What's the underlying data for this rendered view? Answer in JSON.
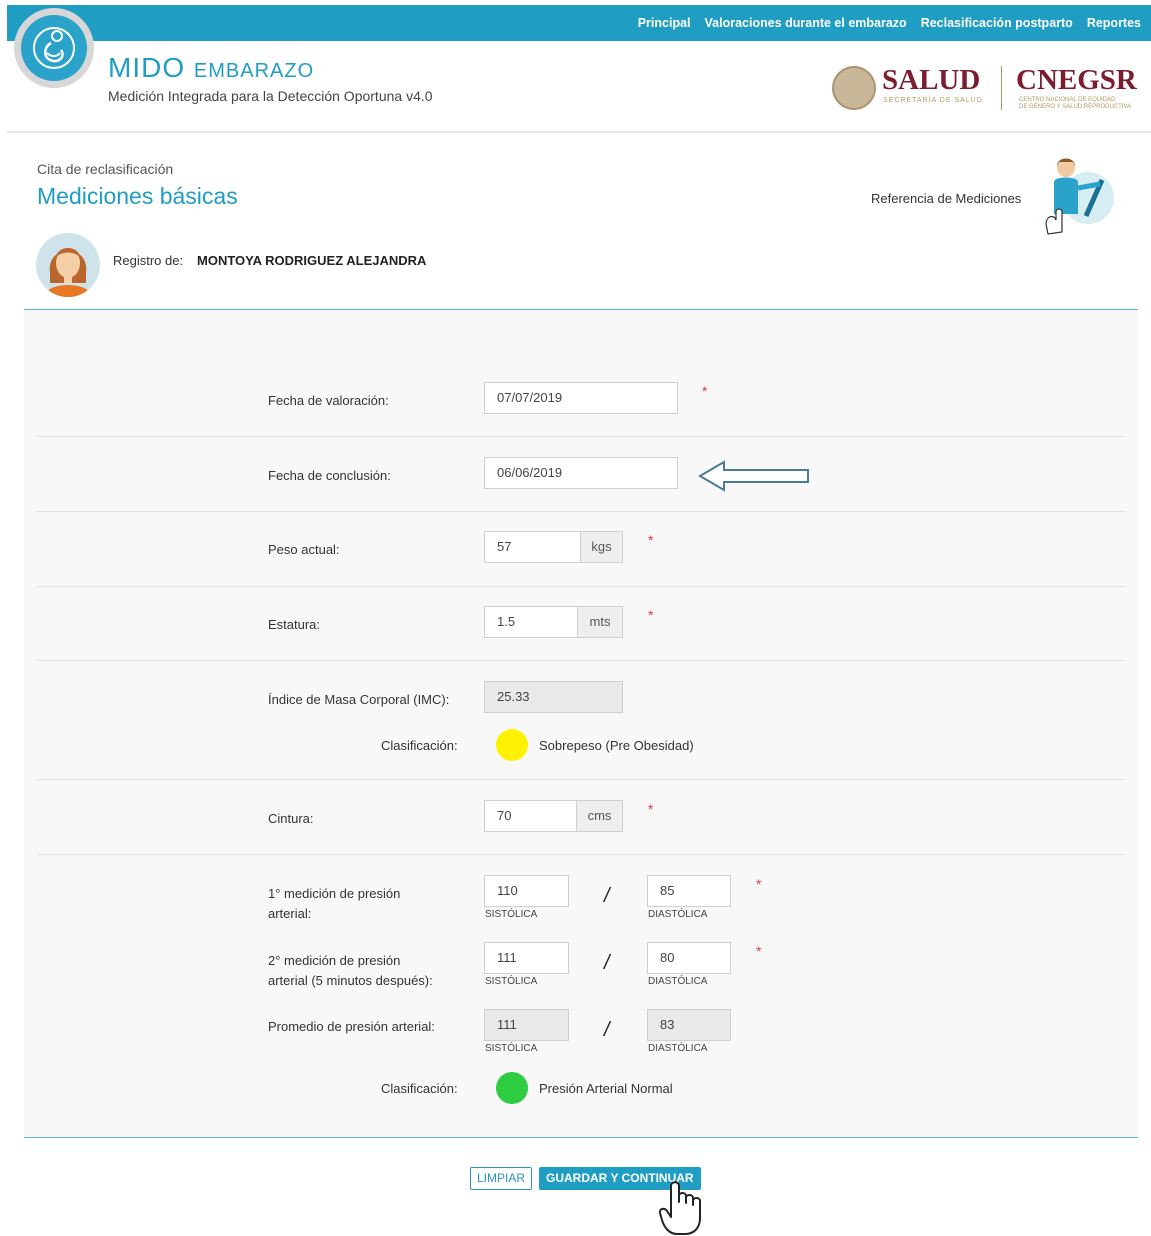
{
  "nav": {
    "items": [
      "Principal",
      "Valoraciones durante el embarazo",
      "Reclasificación postparto",
      "Reportes"
    ]
  },
  "brand": {
    "title_main": "MIDO",
    "title_small": "EMBARAZO",
    "subtitle": "Medición Integrada para la Detección Oportuna v4.0"
  },
  "partners": {
    "salud": "SALUD",
    "salud_sub": "SECRETARÍA DE SALUD",
    "cnegsr": "CNEGSR",
    "cnegsr_sub1": "CENTRO NACIONAL DE EQUIDAD",
    "cnegsr_sub2": "DE GÉNERO Y SALUD REPRODUCTIVA"
  },
  "page": {
    "breadcrumb": "Cita de reclasificación",
    "title": "Mediciones básicas",
    "reference_link": "Referencia de Mediciones",
    "registro_label": "Registro de:",
    "patient_name": "MONTOYA RODRIGUEZ ALEJANDRA"
  },
  "form": {
    "fecha_valoracion": {
      "label": "Fecha de valoración:",
      "value": "07/07/2019"
    },
    "fecha_conclusion": {
      "label": "Fecha de conclusión:",
      "value": "06/06/2019"
    },
    "peso": {
      "label": "Peso actual:",
      "value": "57",
      "unit": "kgs"
    },
    "estatura": {
      "label": "Estatura:",
      "value": "1.5",
      "unit": "mts"
    },
    "imc": {
      "label": "Índice de Masa Corporal (IMC):",
      "value": "25.33"
    },
    "imc_clasificacion": {
      "label": "Clasificación:",
      "text": "Sobrepeso (Pre Obesidad)",
      "color": "#fff200"
    },
    "cintura": {
      "label": "Cintura:",
      "value": "70",
      "unit": "cms"
    },
    "presion1": {
      "label_line1": "1° medición de presión",
      "label_line2": "arterial:",
      "sistolica": "110",
      "diastolica": "85"
    },
    "presion2": {
      "label_line1": "2° medición de presión",
      "label_line2": "arterial (5 minutos después):",
      "sistolica": "111",
      "diastolica": "80"
    },
    "promedio": {
      "label": "Promedio de presión arterial:",
      "sistolica": "111",
      "diastolica": "83"
    },
    "presion_clasificacion": {
      "label": "Clasificación:",
      "text": "Presión Arterial Normal",
      "color": "#2ecc40"
    },
    "hint_sistolica": "SISTÓLICA",
    "hint_diastolica": "DIASTÓLICA",
    "required_mark": "*",
    "slash": "/"
  },
  "buttons": {
    "limpiar": "LIMPIAR",
    "guardar": "GUARDAR Y CONTINUAR"
  }
}
